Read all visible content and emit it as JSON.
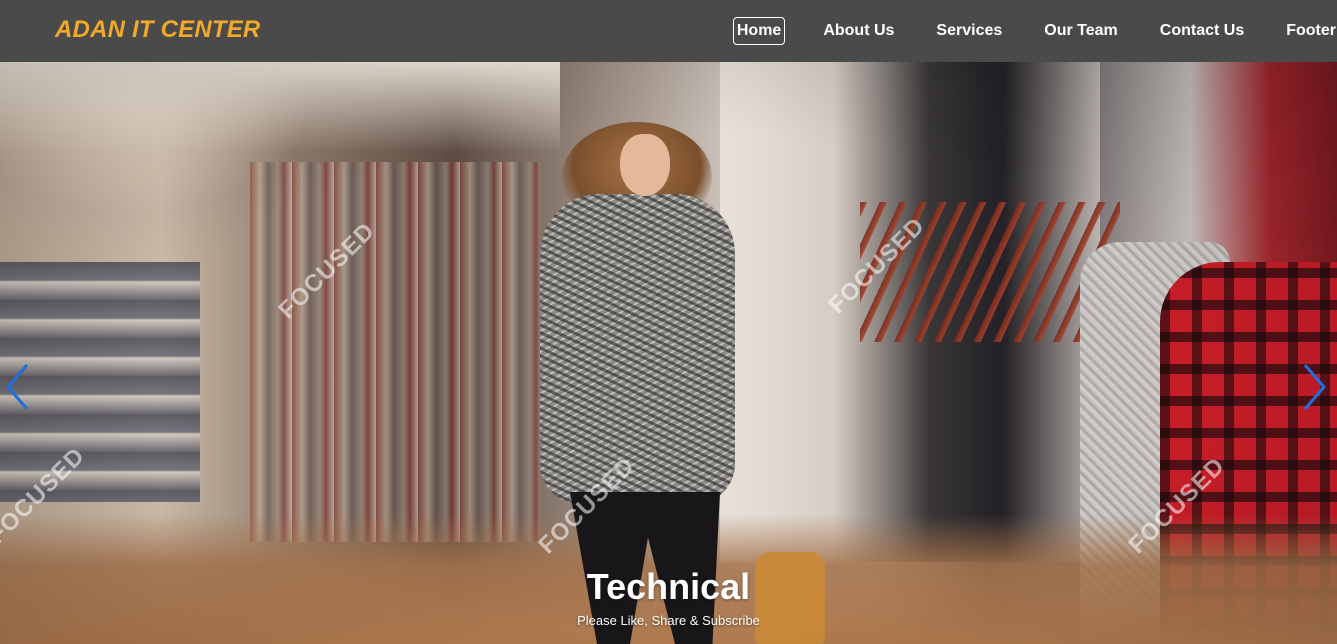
{
  "brand": {
    "title": "ADAN IT CENTER"
  },
  "nav": {
    "items": [
      {
        "label": "Home"
      },
      {
        "label": "About Us"
      },
      {
        "label": "Services"
      },
      {
        "label": "Our Team"
      },
      {
        "label": "Contact Us"
      },
      {
        "label": "Footer"
      }
    ],
    "active_index": 0
  },
  "carousel": {
    "slide": {
      "title": "Technical",
      "subtitle": "Please Like, Share & Subscribe",
      "image_watermark": "FOCUSED"
    },
    "prev_icon": "chevron-left-icon",
    "next_icon": "chevron-right-icon",
    "arrow_color": "#1e6fe0"
  },
  "colors": {
    "navbar_bg": "#4a4a4a",
    "brand": "#f0a928",
    "nav_text": "#ffffff"
  }
}
